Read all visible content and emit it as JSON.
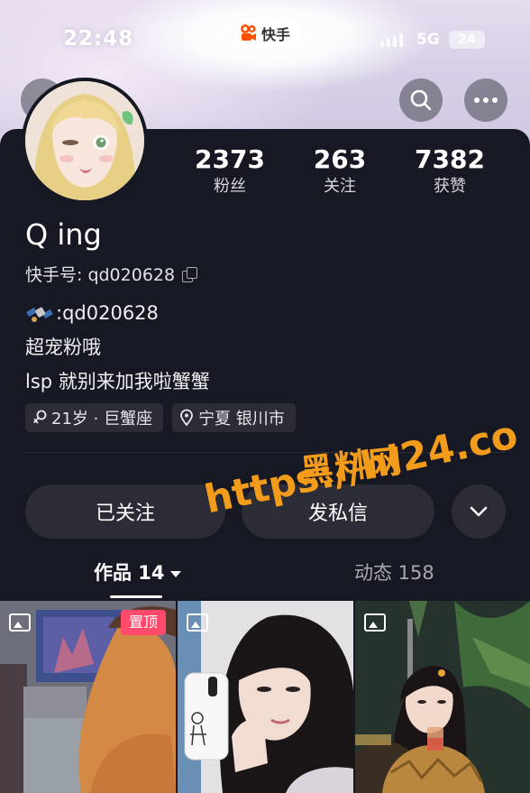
{
  "status_bar": {
    "time": "22:48",
    "app_name": "快手",
    "network": "5G",
    "battery": "24"
  },
  "profile": {
    "stats": [
      {
        "value": "2373",
        "label": "粉丝"
      },
      {
        "value": "263",
        "label": "关注"
      },
      {
        "value": "7382",
        "label": "获赞"
      }
    ],
    "nickname": "Q ing",
    "kuaishou_id": "快手号: qd020628",
    "bio": [
      ":qd020628",
      "超宠粉哦",
      "lsp 就别来加我啦蟹蟹"
    ],
    "tags": [
      {
        "icon": "gender-female-icon",
        "text": "21岁 · 巨蟹座"
      },
      {
        "icon": "location-pin-icon",
        "text": "宁夏 银川市"
      }
    ]
  },
  "actions": {
    "following_label": "已关注",
    "message_label": "发私信"
  },
  "tabs": {
    "works_label": "作品 14",
    "moments_label": "动态 158"
  },
  "grid": {
    "pinned_label": "置顶"
  },
  "watermark": {
    "line1": "黑料网",
    "line2": "https://hl24.co"
  },
  "colors": {
    "background": "#161823",
    "button": "#2b2c36",
    "pinned_badge": "#ff4a6c",
    "watermark": "#f39c1b"
  }
}
